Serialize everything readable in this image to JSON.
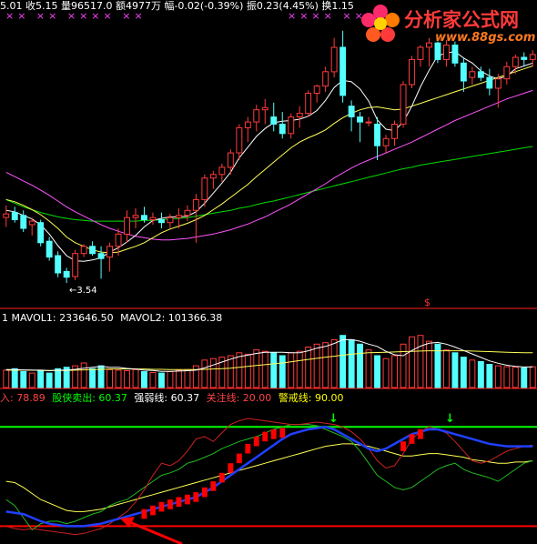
{
  "colors": {
    "background": "#000000",
    "up": "#ff3b3b",
    "down": "#54ffff",
    "ma5": "#ffffff",
    "ma10": "#ffff55",
    "ma20": "#ff55ff",
    "ma60": "#00dd00",
    "divider": "#ff2020",
    "line_green": "#00ff00",
    "line_red": "#ff0000",
    "ind_bar": "#ff0000",
    "blue_line": "#2040ff"
  },
  "header": {
    "top_text": "5.01 收5.15 量96517.0 额4977万 幅-0.02(-0.39%) 振0.23(4.45%) 换1.15",
    "markers_left": "×× ×× ×××× ××",
    "markers_right": "×××× ×× ×"
  },
  "watermark": {
    "title": "分析家公式网",
    "url": "www.88gs.com",
    "icon": "flower-logo-icon"
  },
  "price_panel": {
    "low_label": "←3.54",
    "marker": "$"
  },
  "volume_panel": {
    "label_prefix": "1",
    "mavol1_label": "MAVOL1:",
    "mavol1_value": "233646.50",
    "mavol2_label": "MAVOL2:",
    "mavol2_value": "101366.38"
  },
  "indicator_panel": {
    "label_first": "入: 78.89",
    "label_second": "股侠卖出: 60.37",
    "label_third": "强弱线: 60.37",
    "label_fourth": "关注线: 20.00",
    "label_fifth": "警戒线: 90.00",
    "arrow_marker": "↓"
  },
  "chart_data": [
    {
      "type": "candlestick",
      "candles": [
        [
          4.45,
          4.62,
          4.32,
          4.5
        ],
        [
          4.52,
          4.6,
          4.38,
          4.42
        ],
        [
          4.48,
          4.55,
          4.25,
          4.3
        ],
        [
          4.35,
          4.45,
          4.2,
          4.4
        ],
        [
          4.38,
          4.42,
          4.05,
          4.1
        ],
        [
          4.12,
          4.18,
          3.85,
          3.9
        ],
        [
          3.92,
          3.98,
          3.62,
          3.68
        ],
        [
          3.7,
          3.75,
          3.54,
          3.62
        ],
        [
          3.63,
          4.0,
          3.58,
          3.95
        ],
        [
          3.95,
          4.08,
          3.9,
          4.05
        ],
        [
          4.05,
          4.12,
          3.92,
          3.95
        ],
        [
          3.95,
          4.05,
          3.6,
          3.88
        ],
        [
          3.9,
          4.1,
          3.7,
          4.05
        ],
        [
          4.05,
          4.3,
          3.92,
          4.22
        ],
        [
          4.22,
          4.55,
          4.1,
          4.45
        ],
        [
          4.45,
          4.58,
          4.3,
          4.48
        ],
        [
          4.48,
          4.6,
          4.38,
          4.42
        ],
        [
          4.42,
          4.52,
          4.35,
          4.45
        ],
        [
          4.42,
          4.52,
          4.3,
          4.38
        ],
        [
          4.38,
          4.5,
          4.3,
          4.45
        ],
        [
          4.45,
          4.58,
          4.3,
          4.48
        ],
        [
          4.48,
          4.62,
          4.4,
          4.55
        ],
        [
          4.55,
          4.78,
          4.1,
          4.7
        ],
        [
          4.7,
          5.05,
          4.6,
          5.0
        ],
        [
          5.0,
          5.1,
          4.85,
          5.05
        ],
        [
          5.05,
          5.2,
          4.95,
          5.15
        ],
        [
          5.15,
          5.4,
          5.05,
          5.35
        ],
        [
          5.35,
          5.75,
          5.25,
          5.7
        ],
        [
          5.7,
          5.85,
          5.5,
          5.78
        ],
        [
          5.78,
          6.02,
          5.65,
          5.95
        ],
        [
          5.95,
          6.1,
          5.75,
          5.98
        ],
        [
          5.85,
          6.05,
          5.65,
          5.75
        ],
        [
          5.75,
          5.92,
          5.55,
          5.62
        ],
        [
          5.62,
          5.9,
          5.55,
          5.85
        ],
        [
          5.85,
          6.0,
          5.7,
          5.9
        ],
        [
          5.9,
          6.22,
          5.85,
          6.18
        ],
        [
          6.18,
          6.3,
          6.05,
          6.28
        ],
        [
          6.28,
          6.55,
          6.2,
          6.48
        ],
        [
          6.48,
          6.95,
          6.4,
          6.82
        ],
        [
          6.82,
          7.05,
          6.05,
          6.15
        ],
        [
          6.0,
          6.08,
          5.65,
          5.85
        ],
        [
          5.85,
          5.92,
          5.5,
          5.78
        ],
        [
          5.78,
          5.85,
          5.72,
          5.78
        ],
        [
          5.75,
          5.85,
          5.25,
          5.45
        ],
        [
          5.45,
          5.6,
          5.35,
          5.55
        ],
        [
          5.55,
          5.8,
          5.45,
          5.75
        ],
        [
          5.75,
          6.35,
          5.7,
          6.3
        ],
        [
          6.3,
          6.7,
          6.25,
          6.65
        ],
        [
          6.65,
          6.85,
          6.55,
          6.82
        ],
        [
          6.82,
          6.95,
          6.55,
          6.88
        ],
        [
          6.88,
          6.9,
          6.6,
          6.65
        ],
        [
          6.65,
          6.92,
          6.55,
          6.85
        ],
        [
          6.85,
          6.9,
          6.55,
          6.6
        ],
        [
          6.6,
          6.68,
          6.2,
          6.35
        ],
        [
          6.4,
          6.55,
          6.3,
          6.48
        ],
        [
          6.48,
          6.55,
          6.35,
          6.4
        ],
        [
          6.4,
          6.52,
          6.15,
          6.25
        ],
        [
          6.25,
          6.45,
          5.98,
          6.38
        ],
        [
          6.38,
          6.62,
          6.3,
          6.55
        ],
        [
          6.55,
          6.72,
          6.45,
          6.68
        ],
        [
          6.68,
          6.75,
          6.55,
          6.65
        ],
        [
          6.65,
          6.78,
          6.55,
          6.72
        ]
      ],
      "ma5": [
        4.55,
        4.53,
        4.48,
        4.43,
        4.35,
        4.22,
        4.06,
        3.92,
        3.85,
        3.84,
        3.86,
        3.89,
        3.97,
        4.03,
        4.11,
        4.2,
        4.32,
        4.41,
        4.44,
        4.46,
        4.46,
        4.47,
        4.53,
        4.65,
        4.79,
        4.93,
        5.08,
        5.28,
        5.43,
        5.58,
        5.69,
        5.77,
        5.79,
        5.8,
        5.82,
        5.86,
        5.94,
        6.08,
        6.26,
        6.36,
        6.34,
        6.24,
        6.07,
        5.81,
        5.68,
        5.66,
        5.78,
        6.0,
        6.27,
        6.5,
        6.7,
        6.74,
        6.76,
        6.67,
        6.6,
        6.49,
        6.42,
        6.38,
        6.42,
        6.52,
        6.56,
        6.6
      ],
      "ma10": [
        4.7,
        4.67,
        4.62,
        4.56,
        4.49,
        4.4,
        4.3,
        4.18,
        4.1,
        4.05,
        4.0,
        3.97,
        3.96,
        3.97,
        4.01,
        4.05,
        4.1,
        4.17,
        4.24,
        4.29,
        4.33,
        4.37,
        4.42,
        4.48,
        4.56,
        4.64,
        4.73,
        4.82,
        4.91,
        5.02,
        5.12,
        5.22,
        5.32,
        5.42,
        5.5,
        5.56,
        5.61,
        5.67,
        5.76,
        5.84,
        5.9,
        5.95,
        5.98,
        5.99,
        5.97,
        5.95,
        5.96,
        6.0,
        6.04,
        6.08,
        6.12,
        6.16,
        6.2,
        6.24,
        6.28,
        6.32,
        6.36,
        6.4,
        6.44,
        6.48,
        6.52,
        6.56
      ],
      "ma20": [
        5.08,
        5.02,
        4.96,
        4.9,
        4.83,
        4.76,
        4.68,
        4.6,
        4.53,
        4.47,
        4.41,
        4.35,
        4.3,
        4.26,
        4.22,
        4.19,
        4.17,
        4.15,
        4.14,
        4.14,
        4.15,
        4.16,
        4.18,
        4.2,
        4.22,
        4.25,
        4.28,
        4.32,
        4.36,
        4.41,
        4.46,
        4.52,
        4.58,
        4.64,
        4.71,
        4.78,
        4.85,
        4.92,
        5.0,
        5.07,
        5.14,
        5.2,
        5.25,
        5.3,
        5.35,
        5.4,
        5.45,
        5.5,
        5.56,
        5.62,
        5.68,
        5.74,
        5.8,
        5.85,
        5.9,
        5.95,
        6.0,
        6.05,
        6.1,
        6.14,
        6.18,
        6.22
      ],
      "ma60": [
        4.7,
        4.65,
        4.6,
        4.56,
        4.52,
        4.49,
        4.46,
        4.44,
        4.42,
        4.41,
        4.4,
        4.4,
        4.4,
        4.4,
        4.4,
        4.4,
        4.41,
        4.41,
        4.42,
        4.43,
        4.44,
        4.45,
        4.47,
        4.49,
        4.51,
        4.53,
        4.55,
        4.58,
        4.6,
        4.63,
        4.66,
        4.68,
        4.71,
        4.74,
        4.77,
        4.8,
        4.83,
        4.86,
        4.89,
        4.92,
        4.95,
        4.98,
        5.01,
        5.04,
        5.07,
        5.1,
        5.13,
        5.15,
        5.18,
        5.2,
        5.22,
        5.24,
        5.26,
        5.28,
        5.3,
        5.32,
        5.34,
        5.36,
        5.38,
        5.4,
        5.42,
        5.44
      ],
      "ylim": [
        3.3,
        7.25
      ]
    },
    {
      "type": "bar",
      "volumes": [
        60,
        65,
        55,
        50,
        60,
        50,
        65,
        70,
        75,
        85,
        65,
        75,
        62,
        60,
        58,
        62,
        55,
        52,
        50,
        55,
        60,
        62,
        75,
        95,
        100,
        105,
        110,
        120,
        115,
        130,
        125,
        120,
        110,
        120,
        125,
        140,
        150,
        155,
        165,
        180,
        165,
        150,
        130,
        110,
        100,
        110,
        150,
        175,
        180,
        160,
        150,
        130,
        120,
        105,
        95,
        90,
        80,
        75,
        72,
        70,
        68,
        72
      ],
      "mavol1": [
        62,
        62,
        61,
        60,
        60,
        58,
        60,
        60,
        63,
        67,
        70,
        73,
        70,
        70,
        66,
        64,
        60,
        59,
        56,
        56,
        57,
        58,
        60,
        68,
        78,
        88,
        98,
        107,
        112,
        118,
        122,
        122,
        122,
        120,
        120,
        127,
        136,
        142,
        152,
        165,
        166,
        160,
        150,
        142,
        125,
        113,
        110,
        128,
        143,
        153,
        156,
        150,
        140,
        128,
        116,
        104,
        92,
        84,
        77,
        73,
        71,
        71
      ],
      "mavol2": [
        60,
        60,
        60,
        60,
        59,
        59,
        59,
        59,
        60,
        61,
        62,
        63,
        64,
        64,
        64,
        64,
        64,
        63,
        63,
        62,
        62,
        62,
        62,
        63,
        64,
        65,
        67,
        70,
        73,
        76,
        79,
        82,
        85,
        89,
        93,
        97,
        101,
        105,
        108,
        112,
        115,
        118,
        120,
        121,
        122,
        123,
        124,
        125,
        126,
        127,
        127,
        127,
        127,
        127,
        126,
        125,
        124,
        123,
        122,
        121,
        120,
        120
      ],
      "ylim": [
        0,
        220
      ]
    },
    {
      "type": "line",
      "ylim": [
        0,
        100
      ],
      "red_line": [
        8,
        6,
        5,
        6,
        5,
        4,
        3,
        2,
        1,
        2,
        4,
        6,
        10,
        15,
        20,
        28,
        38,
        50,
        60,
        58,
        62,
        70,
        80,
        82,
        78,
        85,
        92,
        95,
        97,
        96,
        95,
        94,
        93,
        92,
        92,
        93,
        94,
        93,
        92,
        90,
        86,
        80,
        72,
        62,
        56,
        58,
        68,
        80,
        86,
        90,
        88,
        85,
        78,
        70,
        62,
        60,
        62,
        66,
        70,
        72,
        74,
        75
      ],
      "green_line": [
        30,
        25,
        15,
        5,
        10,
        12,
        12,
        10,
        12,
        15,
        18,
        20,
        25,
        28,
        30,
        35,
        40,
        45,
        50,
        52,
        55,
        60,
        62,
        65,
        68,
        72,
        75,
        78,
        80,
        82,
        85,
        88,
        90,
        92,
        92,
        92,
        91,
        88,
        85,
        82,
        78,
        70,
        60,
        50,
        45,
        40,
        38,
        40,
        45,
        50,
        55,
        58,
        60,
        55,
        52,
        50,
        48,
        45,
        50,
        55,
        60,
        62
      ],
      "yellow_line": [
        45,
        44,
        40,
        35,
        30,
        27,
        24,
        21,
        20,
        20,
        21,
        22,
        24,
        26,
        28,
        30,
        32,
        34,
        36,
        38,
        40,
        42,
        44,
        46,
        48,
        50,
        52,
        54,
        56,
        58,
        60,
        62,
        64,
        66,
        68,
        70,
        72,
        74,
        75,
        76,
        76,
        75,
        74,
        72,
        70,
        68,
        66,
        66,
        67,
        68,
        68,
        67,
        66,
        65,
        63,
        62,
        61,
        60,
        60,
        61,
        61,
        62
      ],
      "blue_line": [
        20,
        19,
        18,
        15,
        12,
        10,
        9,
        8,
        8,
        8,
        9,
        10,
        12,
        14,
        16,
        18,
        20,
        22,
        24,
        26,
        28,
        30,
        32,
        36,
        40,
        45,
        50,
        55,
        60,
        65,
        70,
        75,
        80,
        84,
        86,
        88,
        89,
        90,
        88,
        84,
        80,
        76,
        72,
        70,
        72,
        76,
        80,
        84,
        86,
        88,
        88,
        86,
        84,
        82,
        80,
        78,
        76,
        75,
        74,
        74,
        74,
        74
      ],
      "bars": [
        {
          "i": 16,
          "h": 22
        },
        {
          "i": 17,
          "h": 25
        },
        {
          "i": 18,
          "h": 28
        },
        {
          "i": 19,
          "h": 30
        },
        {
          "i": 20,
          "h": 32
        },
        {
          "i": 21,
          "h": 34
        },
        {
          "i": 22,
          "h": 36
        },
        {
          "i": 23,
          "h": 40
        },
        {
          "i": 24,
          "h": 45
        },
        {
          "i": 25,
          "h": 52
        },
        {
          "i": 26,
          "h": 60
        },
        {
          "i": 27,
          "h": 68
        },
        {
          "i": 28,
          "h": 76
        },
        {
          "i": 29,
          "h": 82
        },
        {
          "i": 30,
          "h": 86
        },
        {
          "i": 31,
          "h": 88
        },
        {
          "i": 32,
          "h": 89
        },
        {
          "i": 46,
          "h": 78
        },
        {
          "i": 47,
          "h": 84
        },
        {
          "i": 48,
          "h": 88
        }
      ],
      "ref_lines": [
        20,
        90
      ]
    }
  ]
}
